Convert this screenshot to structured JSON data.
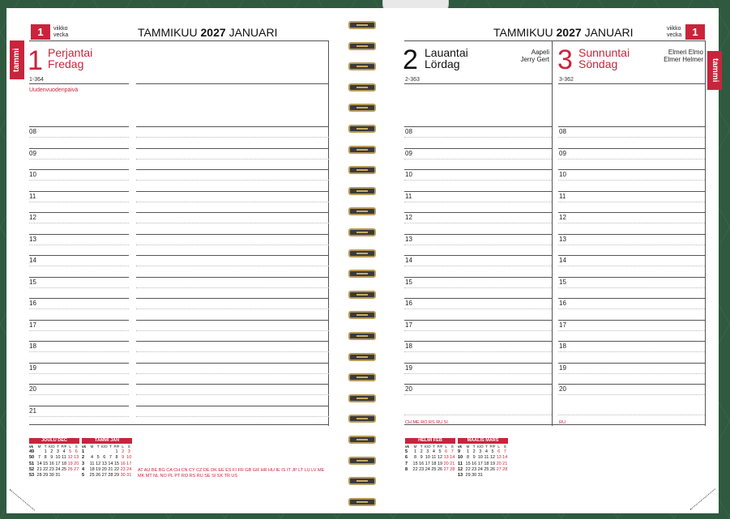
{
  "week": {
    "number": "1",
    "label1": "viikko",
    "label2": "vecka"
  },
  "header": {
    "fi_month": "TAMMIKUU",
    "year": "2027",
    "sv_month": "JANUARI"
  },
  "side_tab": "tammi",
  "days": [
    {
      "num": "1",
      "name_fi": "Perjantai",
      "name_sv": "Fredag",
      "daycount": "1-364",
      "holiday": "Uudenvuodenpäivä",
      "names": ""
    },
    {
      "num": "2",
      "name_fi": "Lauantai",
      "name_sv": "Lördag",
      "daycount": "2-363",
      "holiday": "",
      "names": "Aapeli\nJerry Gert"
    },
    {
      "num": "3",
      "name_fi": "Sunnuntai",
      "name_sv": "Söndag",
      "daycount": "3-362",
      "holiday": "",
      "names": "Elmeri Elmo\nElmer Helmer"
    }
  ],
  "hours": [
    "08",
    "09",
    "10",
    "11",
    "12",
    "13",
    "14",
    "15",
    "16",
    "17",
    "18",
    "19",
    "20",
    "21"
  ],
  "countries_left": "AT AU BE BG CA CH CN CY CZ DE DK EE ES FI FR GB GR HR HU IE IS IT JP LT LU LV ME MK MT NL NO PL PT RO RS RU SE SI SK TR US",
  "countries_day2": "CH ME RO RS RU SI",
  "countries_day3": "RU",
  "mini_cals": [
    {
      "title": "JOULU DEC",
      "days": [
        "vk",
        "M",
        "T",
        "K/O",
        "T",
        "P/F",
        "L",
        "S"
      ],
      "rows": [
        [
          "49",
          "",
          "1",
          "2",
          "3",
          "4",
          "5",
          "6"
        ],
        [
          "50",
          "7",
          "8",
          "9",
          "10",
          "11",
          "12",
          "13"
        ],
        [
          "51",
          "14",
          "15",
          "16",
          "17",
          "18",
          "19",
          "20"
        ],
        [
          "52",
          "21",
          "22",
          "23",
          "24",
          "25",
          "26",
          "27"
        ],
        [
          "53",
          "28",
          "29",
          "30",
          "31",
          "",
          "",
          ""
        ]
      ]
    },
    {
      "title": "TAMMI JAN",
      "days": [
        "vk",
        "M",
        "T",
        "K/O",
        "T",
        "P/F",
        "L",
        "S"
      ],
      "rows": [
        [
          "1",
          "",
          "",
          "",
          "",
          "1",
          "2",
          "3"
        ],
        [
          "2",
          "4",
          "5",
          "6",
          "7",
          "8",
          "9",
          "10"
        ],
        [
          "3",
          "11",
          "12",
          "13",
          "14",
          "15",
          "16",
          "17"
        ],
        [
          "4",
          "18",
          "19",
          "20",
          "21",
          "22",
          "23",
          "24"
        ],
        [
          "5",
          "25",
          "26",
          "27",
          "28",
          "29",
          "30",
          "31"
        ]
      ]
    },
    {
      "title": "HELMI FEB",
      "days": [
        "vk",
        "M",
        "T",
        "K/O",
        "T",
        "P/F",
        "L",
        "S"
      ],
      "rows": [
        [
          "5",
          "1",
          "2",
          "3",
          "4",
          "5",
          "6",
          "7"
        ],
        [
          "6",
          "8",
          "9",
          "10",
          "11",
          "12",
          "13",
          "14"
        ],
        [
          "7",
          "15",
          "16",
          "17",
          "18",
          "19",
          "20",
          "21"
        ],
        [
          "8",
          "22",
          "23",
          "24",
          "25",
          "26",
          "27",
          "28"
        ]
      ]
    },
    {
      "title": "MAALIS MARS",
      "days": [
        "vk",
        "M",
        "T",
        "K/O",
        "T",
        "P/F",
        "L",
        "S"
      ],
      "rows": [
        [
          "9",
          "1",
          "2",
          "3",
          "4",
          "5",
          "6",
          "7"
        ],
        [
          "10",
          "8",
          "9",
          "10",
          "11",
          "12",
          "13",
          "14"
        ],
        [
          "11",
          "15",
          "16",
          "17",
          "18",
          "19",
          "20",
          "21"
        ],
        [
          "12",
          "22",
          "23",
          "24",
          "25",
          "26",
          "27",
          "28"
        ],
        [
          "13",
          "29",
          "30",
          "31",
          "",
          "",
          "",
          ""
        ]
      ]
    }
  ]
}
